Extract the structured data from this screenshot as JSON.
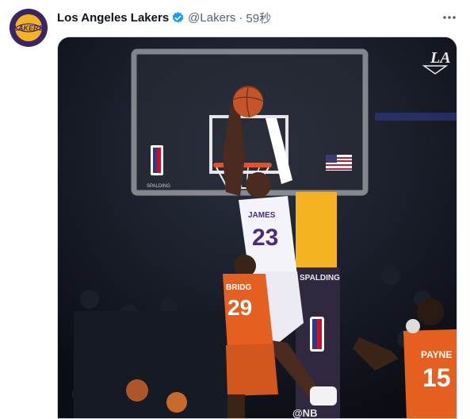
{
  "account": {
    "display_name": "Los Angeles Lakers",
    "handle": "@Lakers",
    "separator": "·",
    "timestamp": "59秒",
    "avatar_text": "LAKERS",
    "verified": true
  },
  "icons": {
    "verified": "verified-badge-icon",
    "more": "more-options-icon",
    "watermark": "la-watermark-icon"
  },
  "media": {
    "player_name": "JAMES",
    "player_number": "23",
    "opponent1_name": "BRIDG",
    "opponent1_number": "29",
    "opponent2_name": "PAYNE",
    "opponent2_number": "15",
    "backboard_brand": "SPALDING",
    "stanchion_brand": "SPALDING",
    "court_watermark": "@NB",
    "watermark_text": "LA"
  },
  "colors": {
    "lakers_purple": "#4b2c7a",
    "lakers_gold": "#f4b320",
    "suns_orange": "#e56020",
    "verified_blue": "#1d9bf0"
  }
}
